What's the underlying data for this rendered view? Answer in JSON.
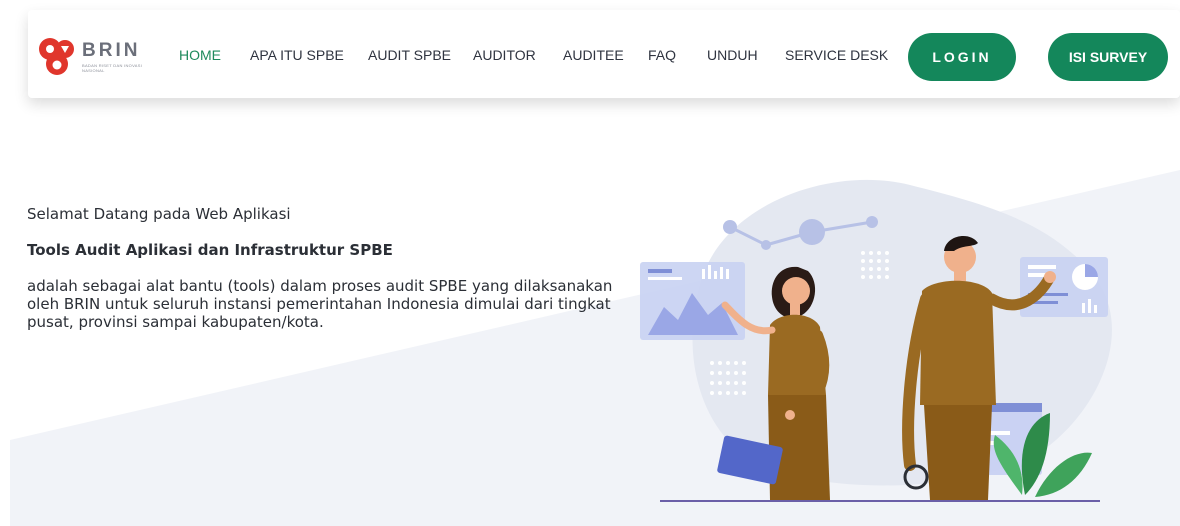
{
  "brand": {
    "name": "BRIN",
    "subtitle": "BADAN RISET DAN INOVASI NASIONAL"
  },
  "nav": {
    "items": [
      {
        "label": "HOME",
        "active": true
      },
      {
        "label": "APA ITU SPBE",
        "active": false
      },
      {
        "label": "AUDIT SPBE",
        "active": false
      },
      {
        "label": "AUDITOR",
        "active": false
      },
      {
        "label": "AUDITEE",
        "active": false
      },
      {
        "label": "FAQ",
        "active": false
      },
      {
        "label": "UNDUH",
        "active": false
      },
      {
        "label": "SERVICE DESK",
        "active": false
      }
    ],
    "login_label": "LOGIN",
    "survey_label": "ISI SURVEY"
  },
  "hero": {
    "welcome": "Selamat Datang pada Web Aplikasi",
    "title": "Tools Audit Aplikasi dan Infrastruktur SPBE",
    "description": "adalah sebagai alat bantu (tools) dalam proses audit SPBE yang dilaksanakan oleh BRIN untuk seluruh instansi pemerintahan Indonesia dimulai dari tingkat pusat, provinsi sampai kabupaten/kota."
  },
  "colors": {
    "accent": "#14875b",
    "active_nav": "#1e8a5c",
    "logo_red": "#e0362c",
    "uniform": "#9a6a22"
  },
  "icons": {
    "logo": "brin-logo-mark",
    "illustration": "auditors-with-dashboards-illustration"
  }
}
